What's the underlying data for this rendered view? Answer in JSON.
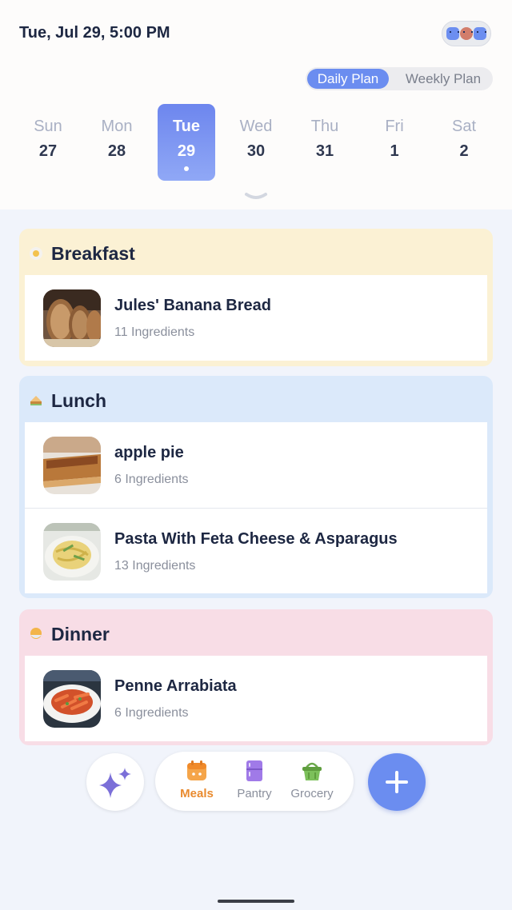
{
  "header": {
    "datetime": "Tue, Jul 29, 5:00 PM",
    "avatar_icon": "family-avatars-icon"
  },
  "plan_toggle": {
    "options": [
      "Daily Plan",
      "Weekly Plan"
    ],
    "selected": "Daily Plan"
  },
  "week": {
    "days": [
      {
        "name": "Sun",
        "date": "27"
      },
      {
        "name": "Mon",
        "date": "28"
      },
      {
        "name": "Tue",
        "date": "29"
      },
      {
        "name": "Wed",
        "date": "30"
      },
      {
        "name": "Thu",
        "date": "31"
      },
      {
        "name": "Fri",
        "date": "1"
      },
      {
        "name": "Sat",
        "date": "2"
      }
    ],
    "selected": "Tue"
  },
  "meals": [
    {
      "title": "Breakfast",
      "color": "#fbf1d4",
      "recipes": [
        {
          "name": "Jules' Banana Bread",
          "ingredients": "11 Ingredients"
        }
      ]
    },
    {
      "title": "Lunch",
      "color": "#dbe9fa",
      "recipes": [
        {
          "name": "apple pie",
          "ingredients": "6 Ingredients"
        },
        {
          "name": "Pasta With Feta Cheese & Asparagus",
          "ingredients": "13 Ingredients"
        }
      ]
    },
    {
      "title": "Dinner",
      "color": "#f8dde6",
      "recipes": [
        {
          "name": "Penne Arrabiata",
          "ingredients": "6 Ingredients"
        }
      ]
    }
  ],
  "nav": {
    "items": [
      {
        "label": "Meals",
        "icon": "calendar-icon"
      },
      {
        "label": "Pantry",
        "icon": "fridge-icon"
      },
      {
        "label": "Grocery",
        "icon": "basket-icon"
      }
    ],
    "active": "Meals",
    "accent": "#e98a2e",
    "primary": "#6b8df0"
  }
}
